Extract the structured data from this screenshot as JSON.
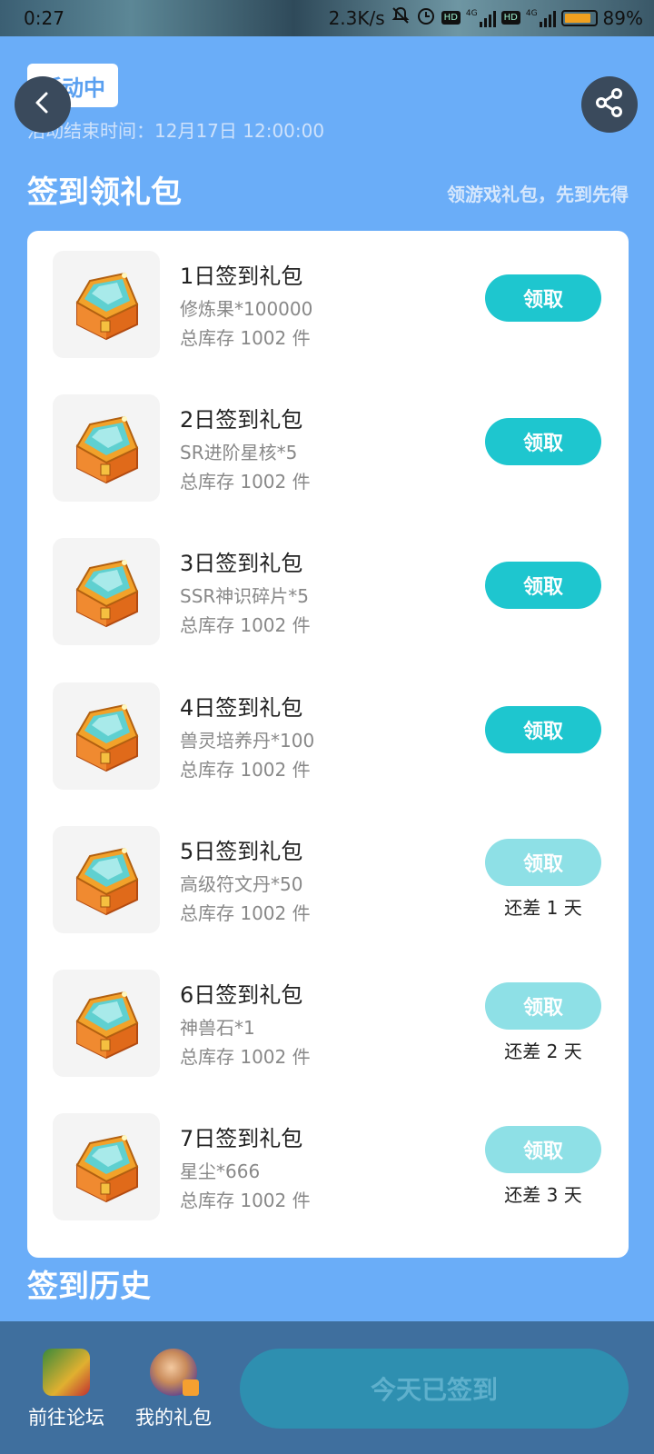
{
  "status_bar": {
    "time": "0:27",
    "net_speed": "2.3K/s",
    "badge1": "HD",
    "net1": "4G",
    "badge2": "HD",
    "net2": "4G",
    "battery": 0.89,
    "battery_text": "89%"
  },
  "header": {
    "status_tag": "活动中",
    "end_time": "活动结束时间：12月17日 12:00:00"
  },
  "section": {
    "title": "签到领礼包",
    "subtitle": "领游戏礼包，先到先得"
  },
  "gifts": [
    {
      "title": "1日签到礼包",
      "desc": "修炼果*100000",
      "stock": "总库存 1002 件",
      "button": "领取",
      "enabled": true,
      "days_left": ""
    },
    {
      "title": "2日签到礼包",
      "desc": "SR进阶星核*5",
      "stock": "总库存 1002 件",
      "button": "领取",
      "enabled": true,
      "days_left": ""
    },
    {
      "title": "3日签到礼包",
      "desc": "SSR神识碎片*5",
      "stock": "总库存 1002 件",
      "button": "领取",
      "enabled": true,
      "days_left": ""
    },
    {
      "title": "4日签到礼包",
      "desc": "兽灵培养丹*100",
      "stock": "总库存 1002 件",
      "button": "领取",
      "enabled": true,
      "days_left": ""
    },
    {
      "title": "5日签到礼包",
      "desc": "高级符文丹*50",
      "stock": "总库存 1002 件",
      "button": "领取",
      "enabled": false,
      "days_left": "还差 1 天"
    },
    {
      "title": "6日签到礼包",
      "desc": "神兽石*1",
      "stock": "总库存 1002 件",
      "button": "领取",
      "enabled": false,
      "days_left": "还差 2 天"
    },
    {
      "title": "7日签到礼包",
      "desc": "星尘*666",
      "stock": "总库存 1002 件",
      "button": "领取",
      "enabled": false,
      "days_left": "还差 3 天"
    }
  ],
  "history": {
    "title": "签到历史"
  },
  "bottom_bar": {
    "forum_label": "前往论坛",
    "my_gifts_label": "我的礼包",
    "signed_label": "今天已签到"
  },
  "colors": {
    "background": "#6aadf8",
    "accent": "#1ec6cf",
    "accent_disabled": "#8ee0e6",
    "bottom_bar": "#3f6f9e"
  }
}
